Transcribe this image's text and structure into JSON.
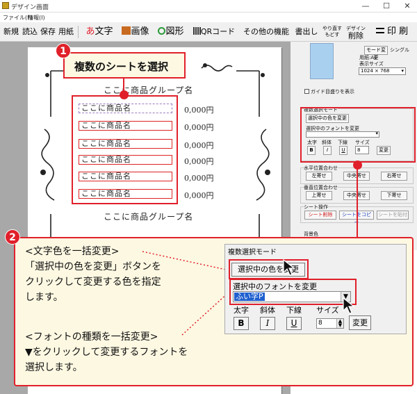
{
  "window": {
    "title": "デザイン画面",
    "minimize": "—",
    "maximize": "☐",
    "close": "✕"
  },
  "menu": {
    "file": "ファイル(F)",
    "info": "情報(I)"
  },
  "toolbar": {
    "new": "新規",
    "read": "読込",
    "save": "保存",
    "paper": "用紙",
    "text_icon": "あ",
    "text": "文字",
    "image": "画像",
    "shape": "図形",
    "qr": "QRコード",
    "other": "その他の機能",
    "print_out": "書出し",
    "redo_top": "やり直す",
    "redo_bottom": "もどす",
    "delete_top": "デザイン",
    "delete": "削除",
    "print": "印 刷"
  },
  "canvas": {
    "group_title": "ここに商品グループ名",
    "group_title_2": "ここに商品グループ名",
    "rows": [
      {
        "name": "ここに商品名",
        "price": "0,000円"
      },
      {
        "name": "ここに商品名",
        "price": "0,000円"
      },
      {
        "name": "ここに商品名",
        "price": "0,000円"
      },
      {
        "name": "ここに商品名",
        "price": "0,000円"
      },
      {
        "name": "ここに商品名",
        "price": "0,000円"
      },
      {
        "name": "ここに商品名",
        "price": "0,000円"
      }
    ]
  },
  "callout1": {
    "number": "1",
    "text": "複数のシートを選択"
  },
  "right_panel": {
    "mode_change": "モード変更",
    "single": "シングル",
    "paper_label": "用紙:A4",
    "display_size": "表示サイズ",
    "display_value": "1024 × 768",
    "guide": "ガイド目盛りを表示",
    "multi_mode": "複数選択モード",
    "change_color": "選択中の色を変更",
    "font_label": "選択中のフォントを変更",
    "bold": "太字",
    "italic": "斜体",
    "underline": "下線",
    "size": "サイズ",
    "size_value": "8",
    "apply": "変更",
    "h_align": "水平位置合わせ",
    "left": "左寄せ",
    "center1": "中央寄せ",
    "right": "右寄せ",
    "v_align": "垂直位置合わせ",
    "top": "上寄せ",
    "center2": "中央寄せ",
    "bottom": "下寄せ",
    "sheet_ops": "シート操作",
    "sheet_delete": "シート削除",
    "sheet_copy": "シートをコピー",
    "sheet_paste": "シートを貼付",
    "bg_color": "背景色"
  },
  "callout2": {
    "number": "2",
    "line1": "<文字色を一括変更>",
    "line2": "「選択中の色を変更」ボタンを",
    "line3": "クリックして変更する色を指定",
    "line4": "します。",
    "line5": "<フォントの種類を一括変更>",
    "line6": "▼をクリックして変更するフォントを",
    "line7": "選択します。"
  },
  "zoom_dialog": {
    "title": "複数選択モード",
    "change_color": "選択中の色を変更",
    "font_label": "選択中のフォントを変更",
    "font_value": "ふい字P",
    "bold_label": "太字",
    "italic_label": "斜体",
    "underline_label": "下線",
    "size_label": "サイズ",
    "bold": "B",
    "italic": "I",
    "underline": "U",
    "size_value": "8",
    "apply": "変更"
  }
}
